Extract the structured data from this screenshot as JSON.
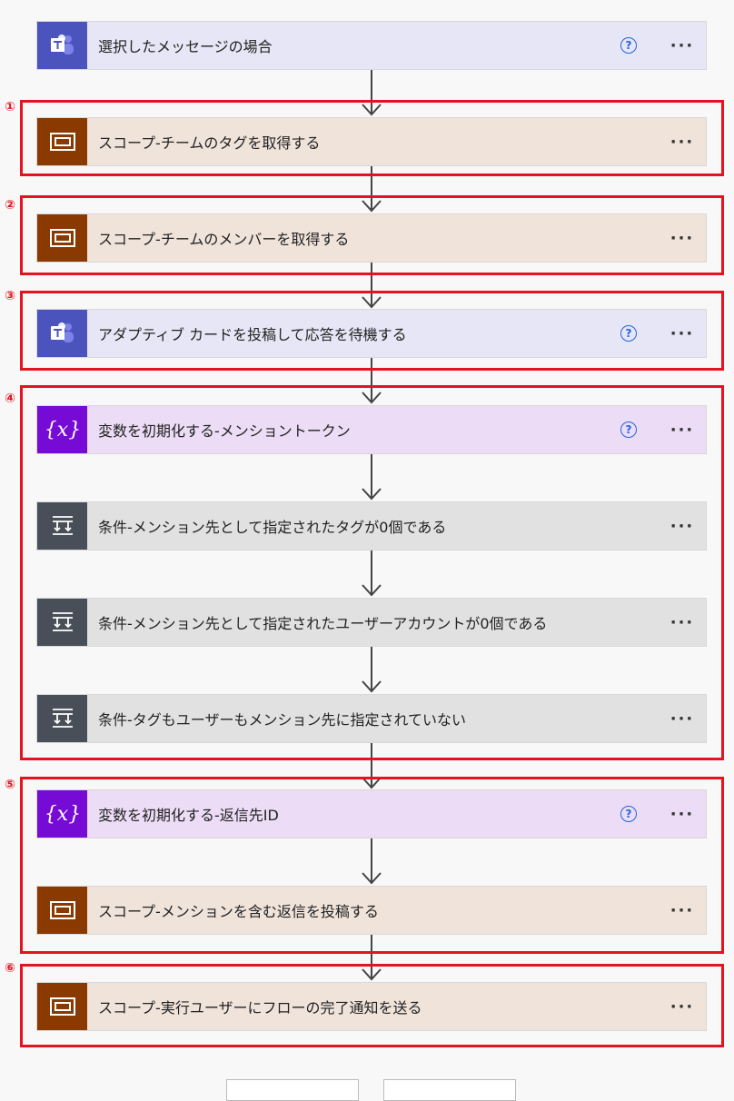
{
  "steps": [
    {
      "label": "選択したメッセージの場合",
      "type": "teams",
      "help": true,
      "icon": "teams-icon"
    },
    {
      "label": "スコープ-チームのタグを取得する",
      "type": "scope",
      "help": false,
      "icon": "scope-icon"
    },
    {
      "label": "スコープ-チームのメンバーを取得する",
      "type": "scope",
      "help": false,
      "icon": "scope-icon"
    },
    {
      "label": "アダプティブ カードを投稿して応答を待機する",
      "type": "teams",
      "help": true,
      "icon": "teams-icon"
    },
    {
      "label": "変数を初期化する-メンショントークン",
      "type": "variable",
      "help": true,
      "icon": "variable-icon"
    },
    {
      "label": "条件-メンション先として指定されたタグが0個である",
      "type": "condition",
      "help": false,
      "icon": "condition-icon"
    },
    {
      "label": "条件-メンション先として指定されたユーザーアカウントが0個である",
      "type": "condition",
      "help": false,
      "icon": "condition-icon"
    },
    {
      "label": "条件-タグもユーザーもメンション先に指定されていない",
      "type": "condition",
      "help": false,
      "icon": "condition-icon"
    },
    {
      "label": "変数を初期化する-返信先ID",
      "type": "variable",
      "help": true,
      "icon": "variable-icon"
    },
    {
      "label": "スコープ-メンションを含む返信を投稿する",
      "type": "scope",
      "help": false,
      "icon": "scope-icon"
    },
    {
      "label": "スコープ-実行ユーザーにフローの完了通知を送る",
      "type": "scope",
      "help": false,
      "icon": "scope-icon"
    }
  ],
  "help_symbol": "?",
  "more_symbol": "···",
  "badges": [
    "①",
    "②",
    "③",
    "④",
    "⑤",
    "⑥"
  ],
  "colors": {
    "highlight_frame": "#e3131f",
    "teams": "#4b53bc",
    "scope": "#8a3a00",
    "variable": "#770bd6",
    "condition": "#484f58",
    "help_accent": "#2266dd"
  }
}
